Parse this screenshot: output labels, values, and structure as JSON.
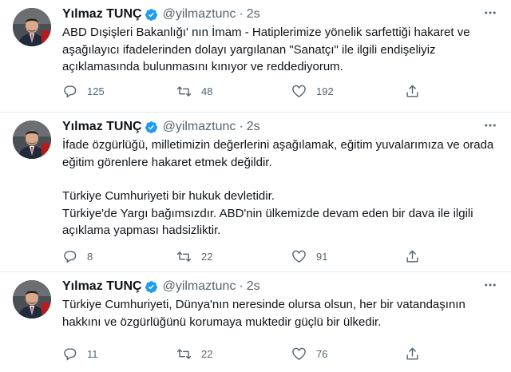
{
  "tweets": [
    {
      "author_name": "Yılmaz TUNÇ",
      "handle": "@yilmaztunc",
      "separator": "·",
      "time": "2s",
      "paragraphs": [
        "ABD Dışişleri Bakanlığı' nın İmam - Hatiplerimize yönelik sarfettiği hakaret ve aşağılayıcı ifadelerinden dolayı yargılanan \"Sanatçı\" ile ilgili endişeliyiz açıklamasında bulunmasını kınıyor ve reddediyorum."
      ],
      "replies": "125",
      "retweets": "48",
      "likes": "192"
    },
    {
      "author_name": "Yılmaz TUNÇ",
      "handle": "@yilmaztunc",
      "separator": "·",
      "time": "2s",
      "paragraphs": [
        "İfade özgürlüğü, milletimizin değerlerini aşağılamak, eğitim yuvalarımıza ve orada eğitim görenlere hakaret etmek değildir.",
        "Türkiye Cumhuriyeti bir hukuk devletidir.",
        "Türkiye'de Yargı bağımsızdır.  ABD'nin ülkemizde devam eden bir dava ile ilgili açıklama yapması hadsizliktir."
      ],
      "replies": "8",
      "retweets": "22",
      "likes": "91"
    },
    {
      "author_name": "Yılmaz TUNÇ",
      "handle": "@yilmaztunc",
      "separator": "·",
      "time": "2s",
      "paragraphs": [
        "Türkiye Cumhuriyeti, Dünya'nın neresinde olursa olsun, her bir vatandaşının hakkını ve özgürlüğünü korumaya muktedir güçlü bir ülkedir."
      ],
      "replies": "11",
      "retweets": "22",
      "likes": "76"
    }
  ],
  "icons": {
    "avatar": "profile-photo",
    "verified": "verified-badge-icon",
    "more": "more-horizontal-icon",
    "reply": "reply-icon",
    "retweet": "retweet-icon",
    "like": "heart-icon",
    "share": "share-icon"
  },
  "colors": {
    "text": "#0f1419",
    "secondary": "#536471",
    "verified": "#1d9bf0",
    "divider": "#e6ecf0"
  }
}
